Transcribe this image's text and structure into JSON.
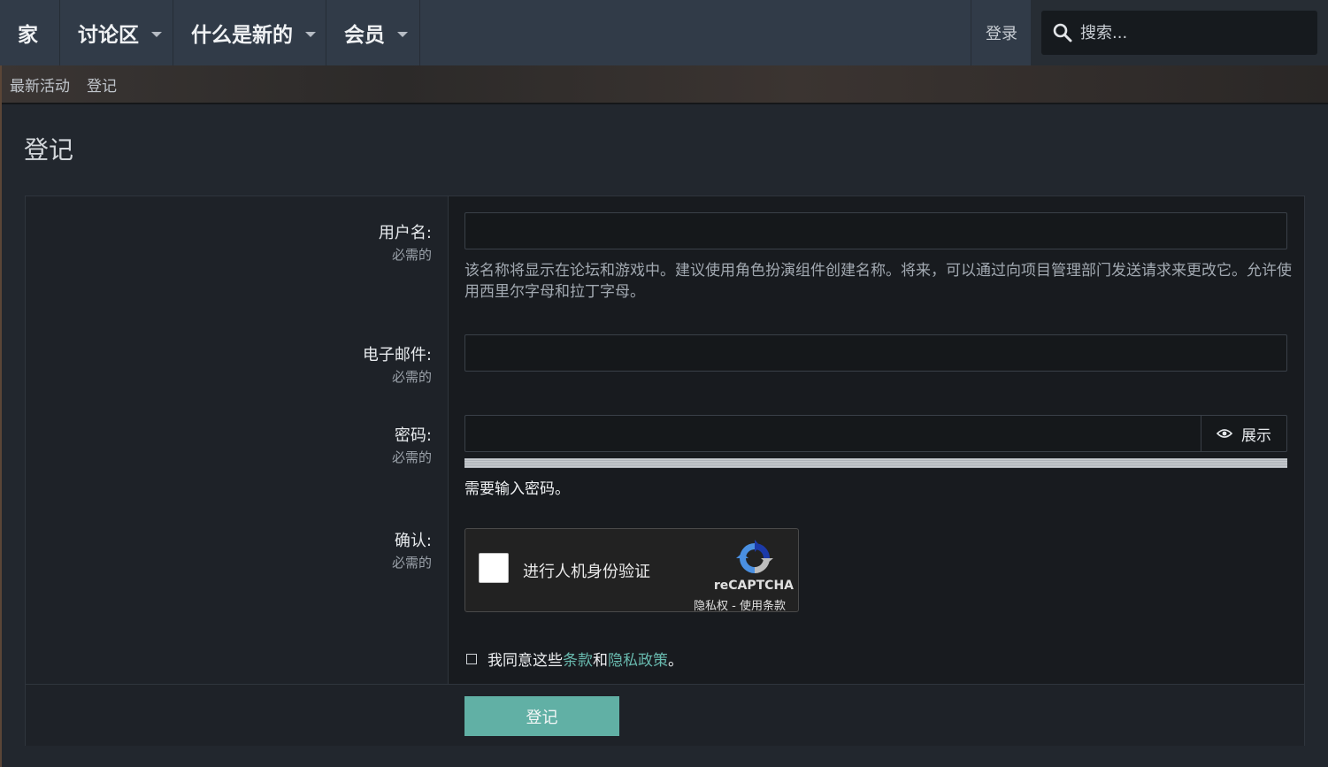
{
  "nav": {
    "tabs": [
      {
        "label": "家",
        "has_dropdown": false
      },
      {
        "label": "讨论区",
        "has_dropdown": true
      },
      {
        "label": "什么是新的",
        "has_dropdown": true
      },
      {
        "label": "会员",
        "has_dropdown": true
      }
    ],
    "login_label": "登录",
    "search_placeholder": "搜索..."
  },
  "subnav": {
    "items": [
      "最新活动",
      "登记"
    ]
  },
  "page_title": "登记",
  "form": {
    "username": {
      "label": "用户名:",
      "hint": "必需的",
      "value": "",
      "help": "该名称将显示在论坛和游戏中。建议使用角色扮演组件创建名称。将来，可以通过向项目管理部门发送请求来更改它。允许使用西里尔字母和拉丁字母。"
    },
    "email": {
      "label": "电子邮件:",
      "hint": "必需的",
      "value": ""
    },
    "password": {
      "label": "密码:",
      "hint": "必需的",
      "value": "",
      "show_label": "展示",
      "strength_message": "需要输入密码。"
    },
    "confirm": {
      "label": "确认:",
      "hint": "必需的",
      "recaptcha_text": "进行人机身份验证",
      "recaptcha_brand": "reCAPTCHA",
      "recaptcha_links": "隐私权 - 使用条款"
    },
    "agree": {
      "prefix": "我同意这些",
      "terms": "条款",
      "middle": "和",
      "privacy": "隐私政策",
      "suffix": "。",
      "checked": false
    },
    "submit_label": "登记"
  },
  "colors": {
    "accent": "#61b0a5",
    "link": "#68b9ae",
    "nav_bg": "#313b48"
  }
}
